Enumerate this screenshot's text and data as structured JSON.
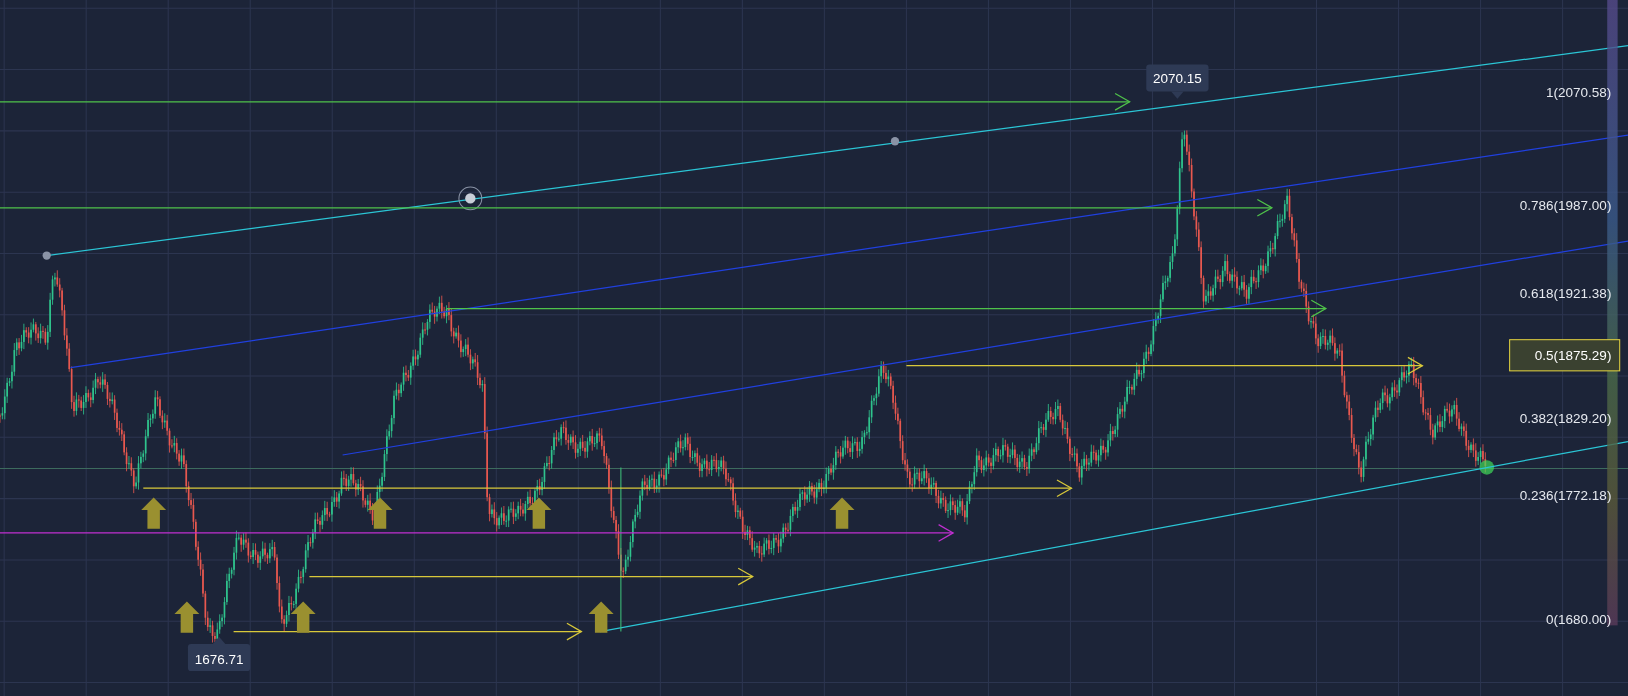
{
  "chart": {
    "callouts": [
      {
        "label": "2070.15",
        "kind": "high"
      },
      {
        "label": "1676.71",
        "kind": "low"
      }
    ],
    "fib_levels": [
      {
        "label": "1(2070.58)",
        "selected": false
      },
      {
        "label": "0.786(1987.00)",
        "selected": false
      },
      {
        "label": "0.618(1921.38)",
        "selected": false
      },
      {
        "label": "0.5(1875.29)",
        "selected": true
      },
      {
        "label": "0.382(1829.20)",
        "selected": false
      },
      {
        "label": "0.236(1772.18)",
        "selected": false
      },
      {
        "label": "0(1680.00)",
        "selected": false
      }
    ]
  }
}
